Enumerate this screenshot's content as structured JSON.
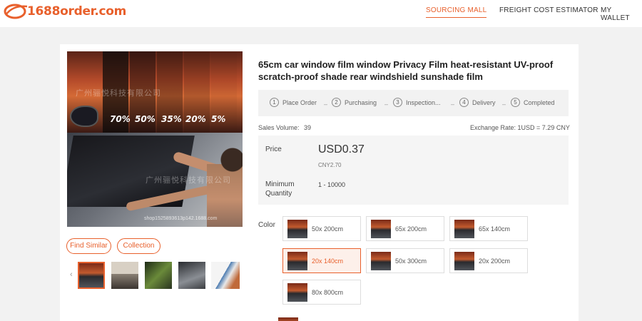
{
  "header": {
    "logo": "1688order.com",
    "nav": [
      "SOURCING MALL",
      "FREIGHT COST ESTIMATOR",
      "MY WALLET"
    ]
  },
  "gallery": {
    "strip_labels": [
      "70%",
      "50%",
      "35%",
      "20%",
      "5%"
    ],
    "watermark": "广州骊悦科技有限公司",
    "watermark_small": "shop1525893613p142.1688.com",
    "find_similar": "Find Similar",
    "collection": "Collection",
    "left_arrow": "‹"
  },
  "product": {
    "title": "65cm car window film window Privacy Film heat-resistant UV-proof scratch-proof shade rear windshield sunshade film",
    "steps": [
      {
        "num": "1",
        "label": "Place Order"
      },
      {
        "num": "2",
        "label": "Purchasing"
      },
      {
        "num": "3",
        "label": "Inspection..."
      },
      {
        "num": "4",
        "label": "Delivery"
      },
      {
        "num": "5",
        "label": "Completed"
      }
    ],
    "step_separator": "–",
    "sales_volume_label": "Sales Volume:",
    "sales_volume": "39",
    "exchange_rate": "Exchange Rate: 1USD = 7.29 CNY",
    "price_label": "Price",
    "price_usd": "USD0.37",
    "price_cny": "CNY2.70",
    "min_qty_label_1": "Minimum",
    "min_qty_label_2": "Quantity",
    "min_qty_range": "1 - 10000",
    "color_label": "Color",
    "options": [
      "50x 200cm",
      "65x 200cm",
      "65x 140cm",
      "20x 140cm",
      "50x 300cm",
      "20x 200cm",
      "80x 800cm"
    ],
    "selected_option": "20x 140cm"
  },
  "colors": {
    "accent": "#e8602c",
    "page_bg": "#f2f2f2"
  }
}
